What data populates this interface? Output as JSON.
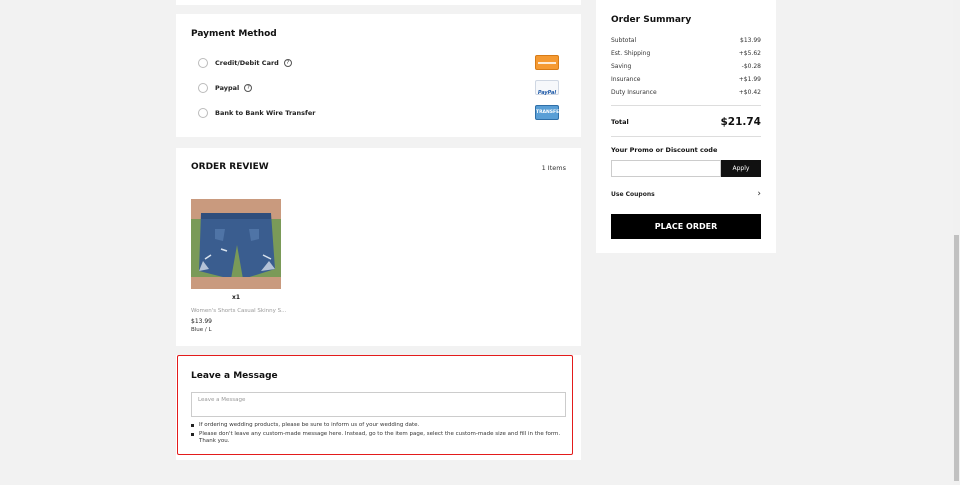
{
  "payment": {
    "title": "Payment Method",
    "options": [
      {
        "label": "Credit/Debit Card",
        "has_help": true,
        "logo": "credit-card-logo"
      },
      {
        "label": "Paypal",
        "has_help": true,
        "logo": "paypal-logo"
      },
      {
        "label": "Bank to Bank Wire Transfer",
        "has_help": false,
        "logo": "wire-transfer-logo"
      }
    ],
    "help_glyph": "?",
    "paypal_logo_text": "PayPal",
    "wire_logo_text": "TRANSFER"
  },
  "review": {
    "title": "ORDER REVIEW",
    "count": "1 Items",
    "item": {
      "qty": "x1",
      "name": "Women's Shorts Casual Skinny S...",
      "price": "$13.99",
      "variant": "Blue / L"
    }
  },
  "message": {
    "title": "Leave a Message",
    "placeholder": "Leave a Message",
    "notes": [
      "If ordering wedding products, please be sure to inform us of your wedding date.",
      "Please don't leave any custom-made message here. Instead, go to the item page, select the custom-made size and fill in the form. Thank you."
    ]
  },
  "summary": {
    "title": "Order Summary",
    "rows": [
      {
        "label": "Subtotal",
        "value": "$13.99"
      },
      {
        "label": "Est. Shipping",
        "value": "+$5.62"
      },
      {
        "label": "Saving",
        "value": "-$0.28"
      },
      {
        "label": "Insurance",
        "value": "+$1.99"
      },
      {
        "label": "Duty Insurance",
        "value": "+$0.42"
      }
    ],
    "total_label": "Total",
    "total_value": "$21.74",
    "promo_label": "Your Promo or Discount code",
    "apply_label": "Apply",
    "coupons_label": "Use Coupons",
    "chevron": "›",
    "place_order_label": "PLACE ORDER"
  },
  "colors": {
    "highlight": "#e31b1b",
    "primary_button": "#000000"
  }
}
